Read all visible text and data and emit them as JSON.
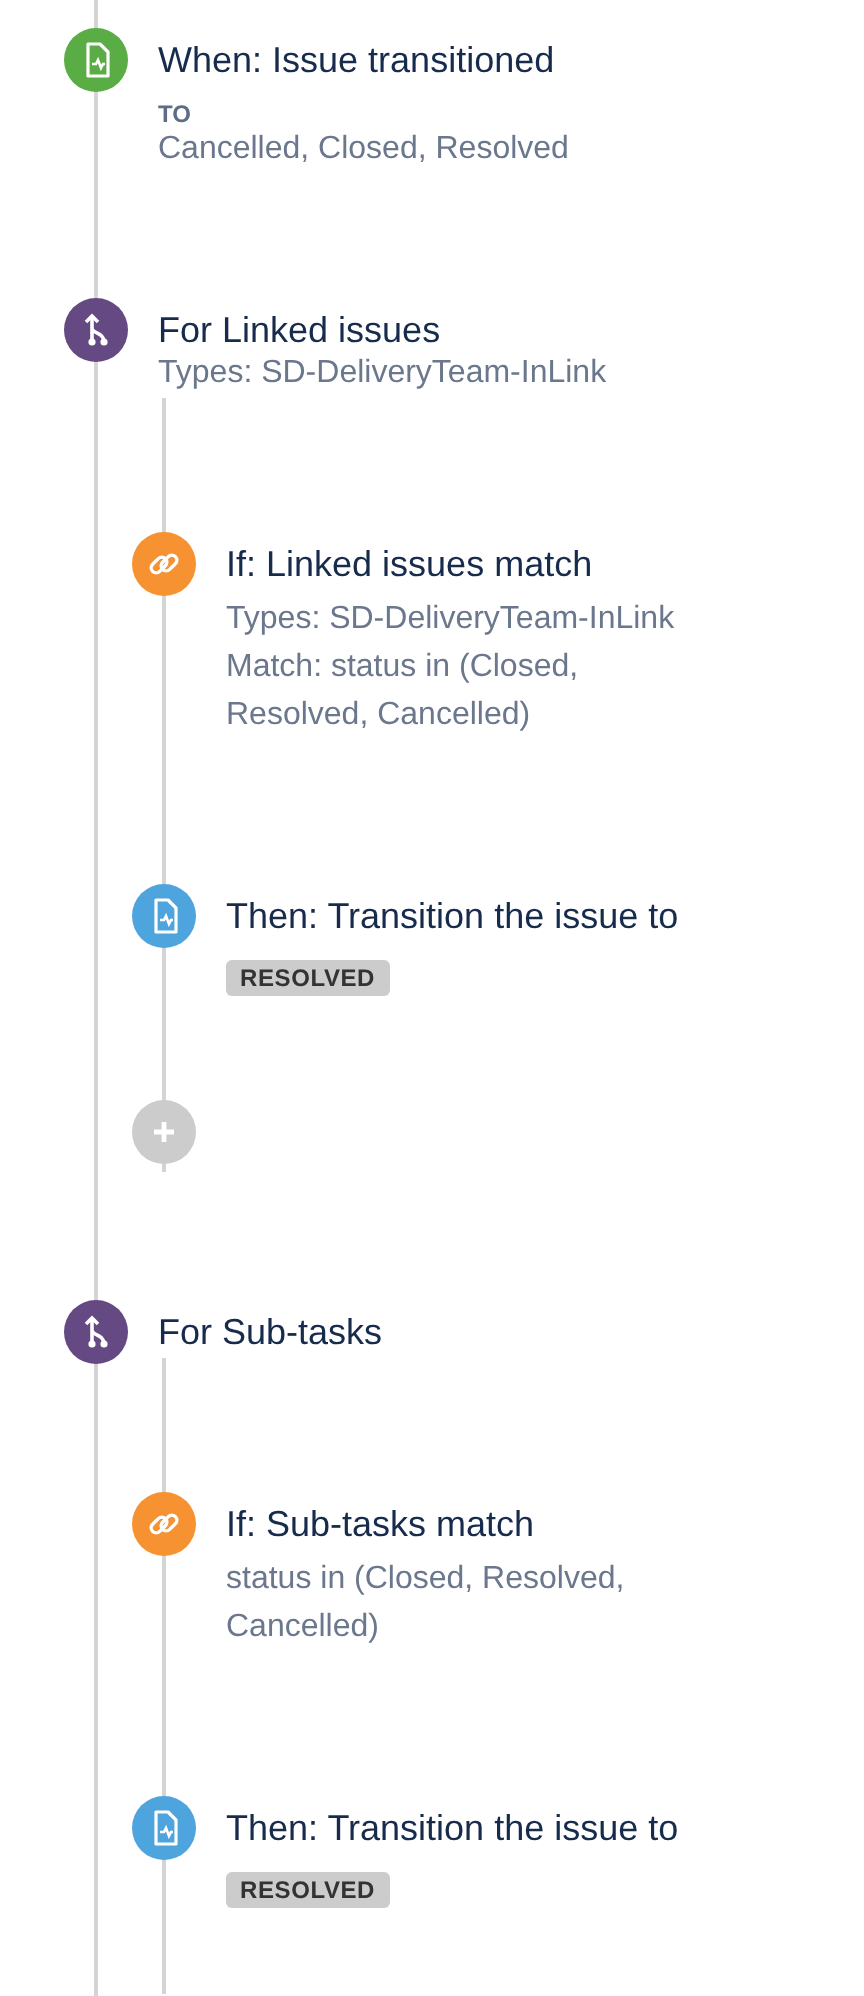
{
  "rule": [
    {
      "kind": "trigger",
      "title": "When: Issue transitioned",
      "label": "TO",
      "value": "Cancelled, Closed, Resolved"
    },
    {
      "kind": "branch",
      "title": "For Linked issues",
      "description": "Types: SD-DeliveryTeam-InLink",
      "children": [
        {
          "kind": "condition",
          "title": "If: Linked issues match",
          "description": "Types: SD-DeliveryTeam-InLink Match: status in (Closed, Resolved, Cancelled)"
        },
        {
          "kind": "action",
          "title": "Then: Transition the issue to",
          "status": "RESOLVED"
        },
        {
          "kind": "add"
        }
      ]
    },
    {
      "kind": "branch",
      "title": "For Sub-tasks",
      "children": [
        {
          "kind": "condition",
          "title": "If: Sub-tasks match",
          "description": "status in (Closed, Resolved, Cancelled)"
        },
        {
          "kind": "action",
          "title": "Then: Transition the issue to",
          "status": "RESOLVED"
        }
      ]
    }
  ]
}
